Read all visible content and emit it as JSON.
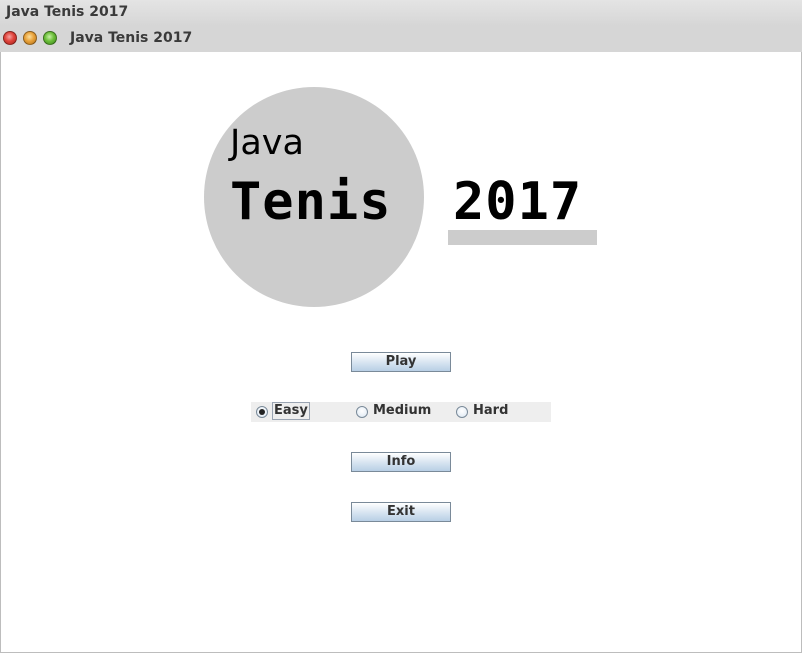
{
  "window": {
    "outer_title": "Java Tenis 2017",
    "inner_title": "Java Tenis 2017"
  },
  "logo": {
    "java": "Java",
    "tenis": "Tenis",
    "year": "2017"
  },
  "buttons": {
    "play": "Play",
    "info": "Info",
    "exit": "Exit"
  },
  "difficulty": {
    "selected": "Easy",
    "options": [
      {
        "label": "Easy",
        "checked": true
      },
      {
        "label": "Medium",
        "checked": false
      },
      {
        "label": "Hard",
        "checked": false
      }
    ]
  }
}
